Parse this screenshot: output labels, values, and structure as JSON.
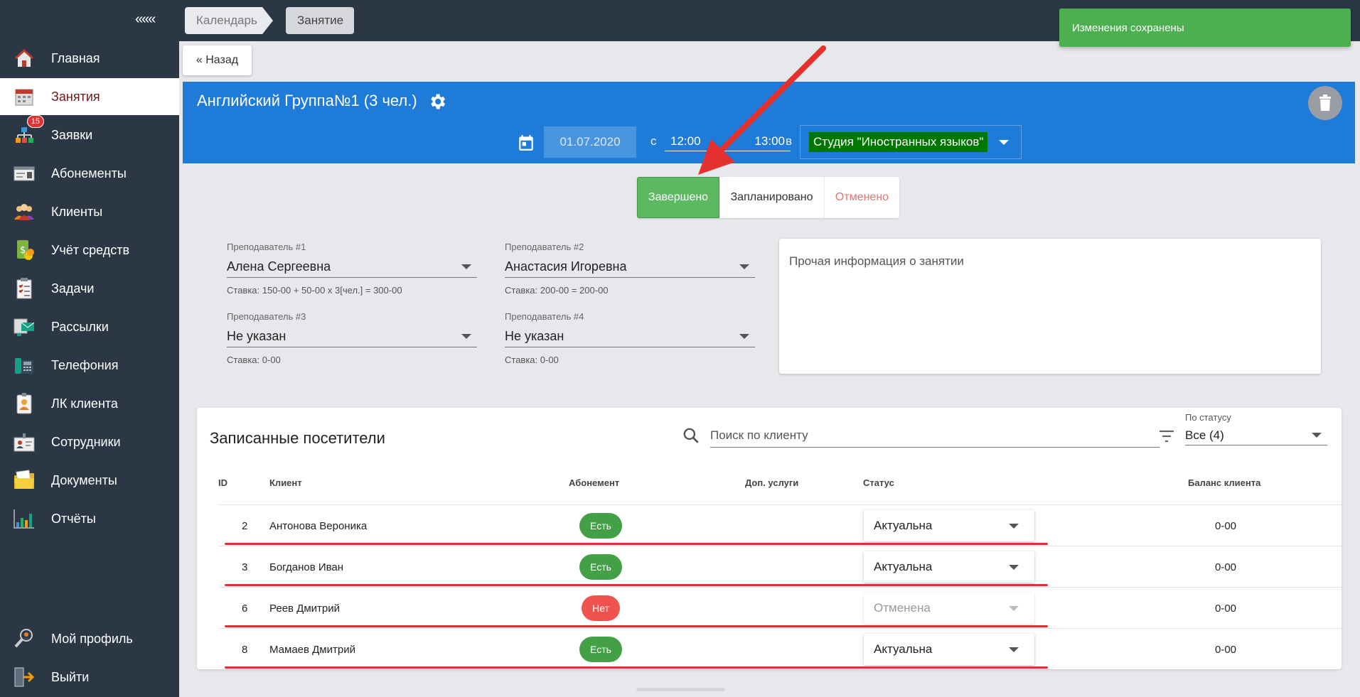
{
  "sidebar": {
    "collapse": "«««",
    "items": [
      {
        "label": "Главная",
        "icon": "home-icon"
      },
      {
        "label": "Занятия",
        "icon": "calendar-icon"
      },
      {
        "label": "Заявки",
        "icon": "requests-icon",
        "badge": "15"
      },
      {
        "label": "Абонементы",
        "icon": "subscription-card-icon"
      },
      {
        "label": "Клиенты",
        "icon": "clients-icon"
      },
      {
        "label": "Учёт средств",
        "icon": "money-icon"
      },
      {
        "label": "Задачи",
        "icon": "tasks-icon"
      },
      {
        "label": "Рассылки",
        "icon": "mailing-icon"
      },
      {
        "label": "Телефония",
        "icon": "phone-icon"
      },
      {
        "label": "ЛК клиента",
        "icon": "client-cabinet-icon"
      },
      {
        "label": "Сотрудники",
        "icon": "staff-icon"
      },
      {
        "label": "Документы",
        "icon": "documents-icon"
      },
      {
        "label": "Отчёты",
        "icon": "reports-icon"
      }
    ],
    "bottom": [
      {
        "label": "Мой профиль",
        "icon": "profile-icon"
      },
      {
        "label": "Выйти",
        "icon": "logout-icon"
      }
    ]
  },
  "breadcrumb": [
    "Календарь",
    "Занятие"
  ],
  "toast": "Изменения сохранены",
  "back_label": "« Назад",
  "lesson": {
    "title": "Английский Группа№1 (3 чел.)",
    "date": "01.07.2020",
    "from_label": "с",
    "time_from": "12:00",
    "time_to": "13:00",
    "in_label": "в",
    "studio": "Студия \"Иностранных языков\""
  },
  "status_buttons": {
    "done": "Завершено",
    "planned": "Запланировано",
    "cancelled": "Отменено"
  },
  "teachers": [
    {
      "label": "Преподаватель #1",
      "value": "Алена Сергеевна",
      "rate": "Ставка: 150-00 + 50-00 x 3[чел.] = 300-00"
    },
    {
      "label": "Преподаватель #2",
      "value": "Анастасия Игоревна",
      "rate": "Ставка: 200-00 = 200-00"
    },
    {
      "label": "Преподаватель #3",
      "value": "Не указан",
      "rate": "Ставка: 0-00"
    },
    {
      "label": "Преподаватель #4",
      "value": "Не указан",
      "rate": "Ставка: 0-00"
    }
  ],
  "notes_placeholder": "Прочая информация о занятии",
  "visitors": {
    "title": "Записанные посетители",
    "search_placeholder": "Поиск по клиенту",
    "filter_label": "По статусу",
    "filter_value": "Все (4)",
    "columns": [
      "ID",
      "Клиент",
      "Абонемент",
      "Доп. услуги",
      "Статус",
      "Баланс клиента"
    ],
    "rows": [
      {
        "id": "2",
        "client": "Антонова Вероника",
        "subscription": "Есть",
        "status": "Актуальна",
        "balance": "0-00"
      },
      {
        "id": "3",
        "client": "Богданов Иван",
        "subscription": "Есть",
        "status": "Актуальна",
        "balance": "0-00"
      },
      {
        "id": "6",
        "client": "Реев Дмитрий",
        "subscription": "Нет",
        "status": "Отменена",
        "balance": "0-00"
      },
      {
        "id": "8",
        "client": "Мамаев Дмитрий",
        "subscription": "Есть",
        "status": "Актуальна",
        "balance": "0-00"
      }
    ]
  },
  "colors": {
    "sidebar": "#2c3745",
    "header_blue": "#1f7bd8",
    "done_green": "#5cb861",
    "toast_green": "#4caf50",
    "annotation_red": "#e53030"
  }
}
